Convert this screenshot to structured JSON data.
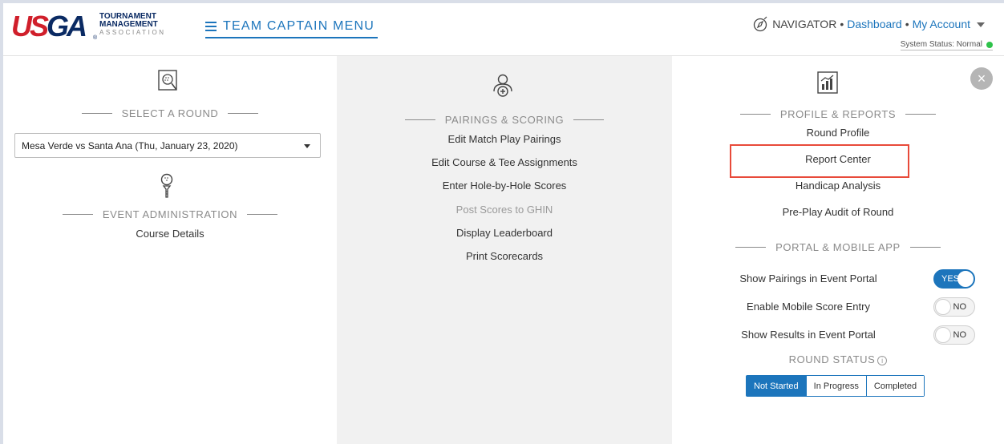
{
  "header": {
    "logo": {
      "usga": "USGA",
      "line1": "TOURNAMENT",
      "line2": "MANAGEMENT",
      "line3": "ASSOCIATION"
    },
    "menu_label": "TEAM CAPTAIN MENU",
    "navigator": "NAVIGATOR",
    "sep": "•",
    "dashboard": "Dashboard",
    "my_account": "My Account",
    "system_status": "System Status: Normal",
    "status_color": "#2ec24a"
  },
  "col1": {
    "select_round_title": "SELECT A ROUND",
    "selected_round": "Mesa Verde vs Santa Ana (Thu, January 23, 2020)",
    "event_admin_title": "EVENT ADMINISTRATION",
    "course_details": "Course Details"
  },
  "col2": {
    "title": "PAIRINGS & SCORING",
    "items": [
      "Edit Match Play Pairings",
      "Edit Course & Tee Assignments",
      "Enter Hole-by-Hole Scores",
      "Post Scores to GHIN",
      "Display Leaderboard",
      "Print Scorecards"
    ]
  },
  "col3": {
    "close": "×",
    "profile_title": "PROFILE & REPORTS",
    "profile_items": [
      "Round Profile",
      "Report Center",
      "Handicap Analysis",
      "Pre-Play Audit of Round"
    ],
    "portal_title": "PORTAL & MOBILE APP",
    "toggles": [
      {
        "label": "Show Pairings in Event Portal",
        "value": "YES"
      },
      {
        "label": "Enable Mobile Score Entry",
        "value": "NO"
      },
      {
        "label": "Show Results in Event Portal",
        "value": "NO"
      }
    ],
    "round_status_title": "ROUND STATUS",
    "info": "i",
    "status_options": [
      "Not Started",
      "In Progress",
      "Completed"
    ],
    "active_status": "Not Started",
    "accent_color": "#1c75bc",
    "highlight_color": "#e84a3a"
  }
}
